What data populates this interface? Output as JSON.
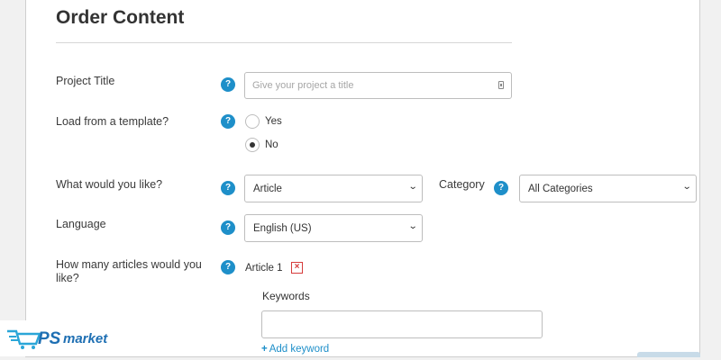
{
  "form": {
    "title": "Order Content",
    "project_title": {
      "label": "Project Title",
      "placeholder": "Give your project a title",
      "value": ""
    },
    "template": {
      "label": "Load from a template?",
      "options": [
        {
          "label": "Yes",
          "checked": false
        },
        {
          "label": "No",
          "checked": true
        }
      ]
    },
    "content_type": {
      "label": "What would you like?",
      "value": "Article"
    },
    "category": {
      "label": "Category",
      "value": "All Categories"
    },
    "language": {
      "label": "Language",
      "value": "English (US)"
    },
    "article_count": {
      "label_line1": "How many articles would you",
      "label_line2": "like?"
    },
    "article": {
      "label": "Article 1",
      "remove": "×"
    },
    "keywords": {
      "label": "Keywords",
      "value": "",
      "add_label": "Add keyword"
    },
    "help_icon": "?"
  },
  "brand": {
    "mark": "PS",
    "text": "market"
  },
  "colors": {
    "accent": "#1e8fc9",
    "danger": "#d63b3b",
    "brand": "#1e6fb3"
  },
  "icons": {
    "help": "help-icon",
    "chevron": "chevron-down-icon",
    "remove": "close-icon",
    "add": "plus-icon",
    "field": "field-icon"
  }
}
